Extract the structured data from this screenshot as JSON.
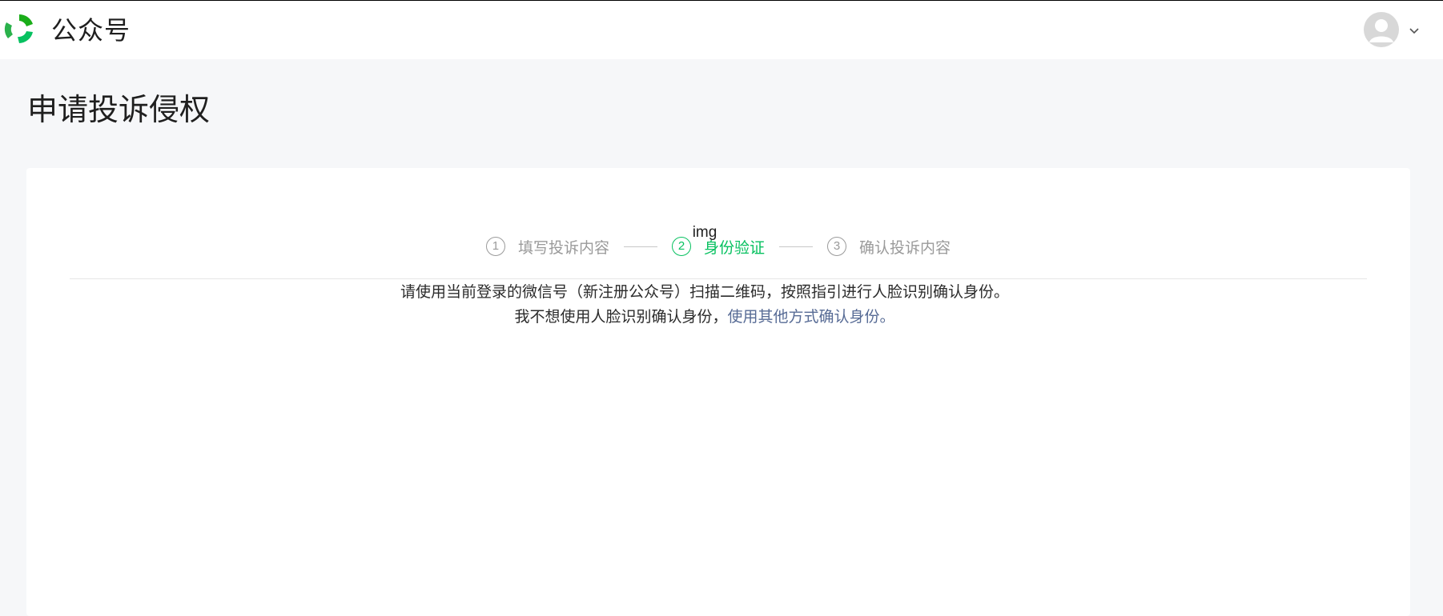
{
  "header": {
    "brand": "公众号",
    "logo_icon": "wechat-official-account-logo",
    "avatar_icon": "user-avatar-icon",
    "dropdown_icon": "chevron-down-icon"
  },
  "page": {
    "title": "申请投诉侵权"
  },
  "steps": [
    {
      "num": "1",
      "label": "填写投诉内容",
      "active": false
    },
    {
      "num": "2",
      "label": "身份验证",
      "active": true
    },
    {
      "num": "3",
      "label": "确认投诉内容",
      "active": false
    }
  ],
  "verify": {
    "qr_alt": "img",
    "instruction": "请使用当前登录的微信号（新注册公众号）扫描二维码，按照指引进行人脸识别确认身份。",
    "alt_prefix": "我不想使用人脸识别确认身份，",
    "alt_link": "使用其他方式确认身份",
    "alt_suffix": "。"
  },
  "colors": {
    "accent": "#07c160",
    "link": "#576b95",
    "inactive": "#9a9a9a"
  }
}
